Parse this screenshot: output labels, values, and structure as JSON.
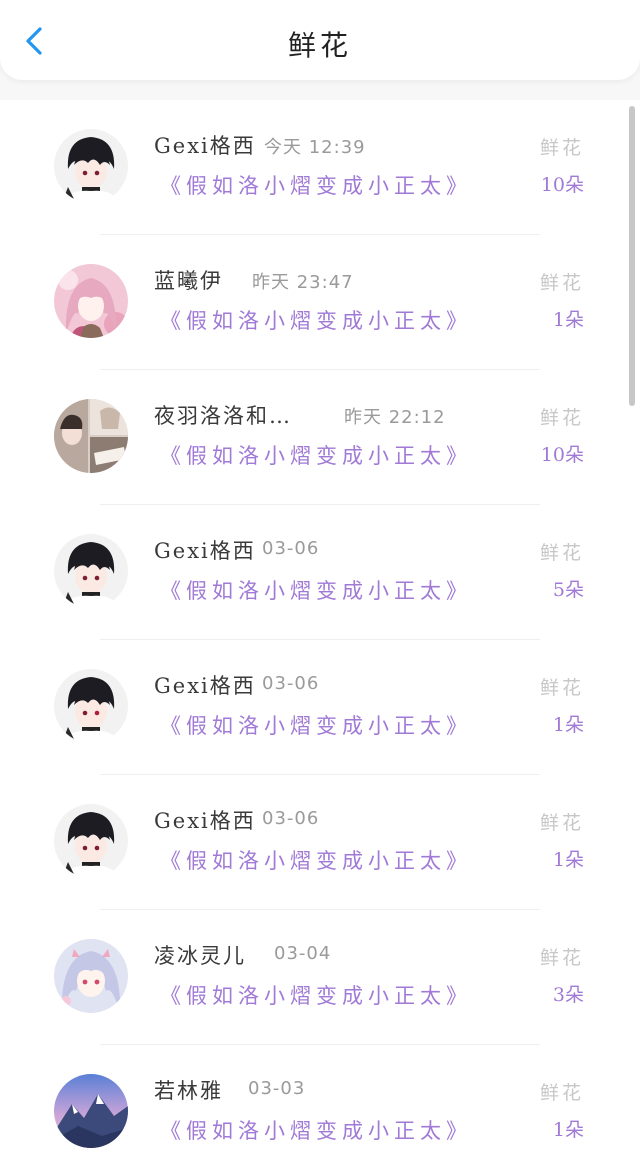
{
  "header": {
    "title": "鲜花",
    "back_icon": "chevron-left-icon",
    "back_color": "#2196f3"
  },
  "colors": {
    "accent": "#a07ad6",
    "muted": "#9a9a9a",
    "label": "#c7c7c7"
  },
  "list": [
    {
      "name": "Gexi格西",
      "time": "今天 12:39",
      "work": "《假如洛小熠变成小正太》",
      "label": "鲜花",
      "count": "10朵",
      "avatar": "dark-haired-boy"
    },
    {
      "name": "蓝曦伊",
      "time": "昨天 23:47",
      "work": "《假如洛小熠变成小正太》",
      "label": "鲜花",
      "count": "1朵",
      "avatar": "pink-haired-girl"
    },
    {
      "name": "夜羽洛洛和…",
      "time": "昨天 22:12",
      "work": "《假如洛小熠变成小正太》",
      "label": "鲜花",
      "count": "10朵",
      "avatar": "photo-collage"
    },
    {
      "name": "Gexi格西",
      "time": "03-06",
      "work": "《假如洛小熠变成小正太》",
      "label": "鲜花",
      "count": "5朵",
      "avatar": "dark-haired-boy"
    },
    {
      "name": "Gexi格西",
      "time": "03-06",
      "work": "《假如洛小熠变成小正太》",
      "label": "鲜花",
      "count": "1朵",
      "avatar": "dark-haired-boy"
    },
    {
      "name": "Gexi格西",
      "time": "03-06",
      "work": "《假如洛小熠变成小正太》",
      "label": "鲜花",
      "count": "1朵",
      "avatar": "dark-haired-boy"
    },
    {
      "name": "凌冰灵儿",
      "time": "03-04",
      "work": "《假如洛小熠变成小正太》",
      "label": "鲜花",
      "count": "3朵",
      "avatar": "anime-girl-light"
    },
    {
      "name": "若林雅",
      "time": "03-03",
      "work": "《假如洛小熠变成小正太》",
      "label": "鲜花",
      "count": "1朵",
      "avatar": "mountain-landscape"
    }
  ]
}
